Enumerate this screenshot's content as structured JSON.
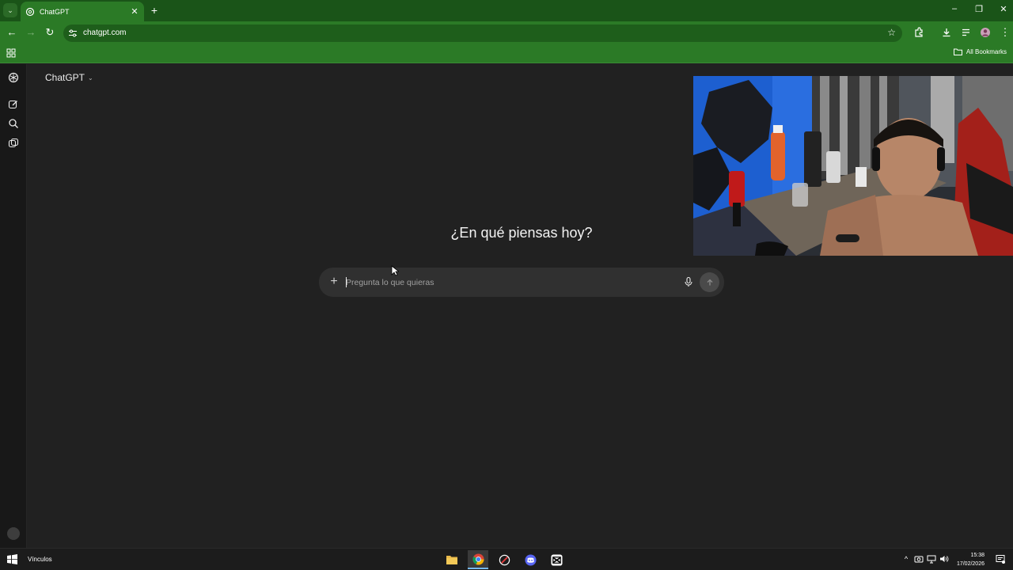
{
  "browser": {
    "tab_title": "ChatGPT",
    "tab_close": "✕",
    "new_tab": "+",
    "url": "chatgpt.com",
    "bookmarks_label": "All Bookmarks",
    "window_controls": {
      "minimize": "–",
      "restore": "❐",
      "close": "✕"
    }
  },
  "app": {
    "model_label": "ChatGPT",
    "headline": "¿En qué piensas hoy?",
    "composer": {
      "placeholder": "Pregunta lo que quieras",
      "plus": "+"
    }
  },
  "taskbar": {
    "vinculos_label": "Vínculos",
    "time": "15:38",
    "date": "17/02/2026",
    "tray_chevron": "^"
  },
  "colors": {
    "chrome_green": "#2b7a26",
    "tabstrip_green": "#1a5418",
    "app_background": "#212121",
    "composer_background": "#303030"
  }
}
